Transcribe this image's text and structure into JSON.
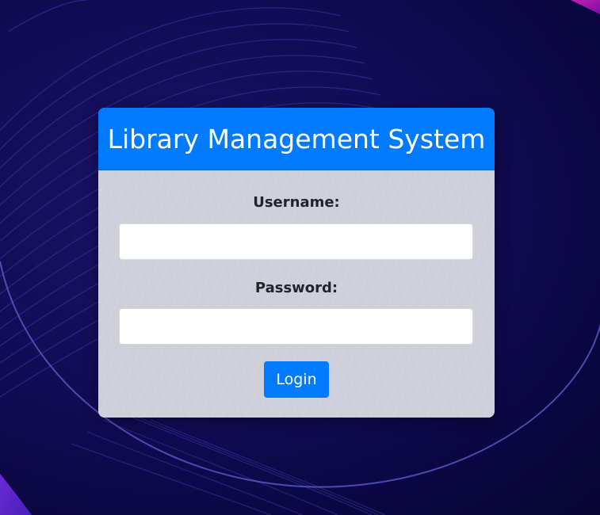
{
  "login": {
    "title": "Library Management System",
    "username_label": "Username:",
    "username_value": "",
    "password_label": "Password:",
    "password_value": "",
    "login_button": "Login"
  },
  "colors": {
    "accent": "#007bff",
    "card_body": "#cfcfd9",
    "background": "#0d0848"
  }
}
